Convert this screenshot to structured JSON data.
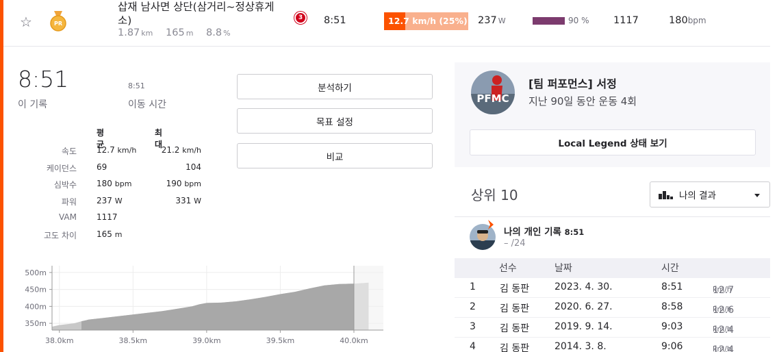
{
  "segment": {
    "name": "삽재 남사면 상단(삼거리~정상휴게소)",
    "distance": "1.87",
    "distance_unit": "km",
    "elev": "165",
    "elev_unit": "m",
    "grade": "8.8",
    "grade_unit": "%",
    "medal_label": "PR",
    "rank_badge": "3",
    "time": "8:51",
    "speed_text": "12.7 km/h (25%)",
    "speed_pct": 0.25,
    "power": "237",
    "power_unit": "W",
    "hr_pct": "90 %",
    "hr_fill": 0.9,
    "vam": "1117",
    "bpm": "180",
    "bpm_unit": "bpm"
  },
  "detail": {
    "elapsed": "8:51",
    "elapsed_label": "이 기록",
    "moving": "8:51",
    "moving_label": "이동 시간",
    "avg_header": "평균",
    "max_header": "최대",
    "rows": [
      {
        "label": "속도",
        "avg": "12.7",
        "avg_unit": "km/h",
        "max": "21.2",
        "max_unit": "km/h"
      },
      {
        "label": "케이던스",
        "avg": "69",
        "avg_unit": "",
        "max": "104",
        "max_unit": ""
      },
      {
        "label": "심박수",
        "avg": "180",
        "avg_unit": "bpm",
        "max": "190",
        "max_unit": "bpm"
      },
      {
        "label": "파워",
        "avg": "237",
        "avg_unit": "W",
        "max": "331",
        "max_unit": "W"
      },
      {
        "label": "VAM",
        "avg": "1117",
        "avg_unit": "",
        "max": "",
        "max_unit": ""
      },
      {
        "label": "고도 차이",
        "avg": "165",
        "avg_unit": "m",
        "max": "",
        "max_unit": ""
      }
    ],
    "buttons": {
      "analyze": "분석하기",
      "goal": "목표 설정",
      "compare": "비교"
    }
  },
  "chart_data": {
    "type": "area",
    "x": [
      37.95,
      38.0,
      38.1,
      38.15,
      38.2,
      38.3,
      38.4,
      38.5,
      38.6,
      38.7,
      38.8,
      38.9,
      38.95,
      39.0,
      39.1,
      39.2,
      39.3,
      39.4,
      39.5,
      39.6,
      39.7,
      39.8,
      39.9,
      40.0,
      40.1
    ],
    "y": [
      340,
      345,
      350,
      356,
      361,
      366,
      371,
      376,
      381,
      386,
      393,
      400,
      406,
      410,
      411,
      415,
      421,
      428,
      436,
      443,
      453,
      462,
      466,
      467,
      470
    ],
    "highlight_range": [
      38.15,
      40.0
    ],
    "x_ticks": [
      "38.0km",
      "38.5km",
      "39.0km",
      "39.5km",
      "40.0km"
    ],
    "x_tick_values": [
      38.0,
      38.5,
      39.0,
      39.5,
      40.0
    ],
    "y_ticks": [
      "350m",
      "400m",
      "450m",
      "500m"
    ],
    "y_tick_values": [
      350,
      400,
      450,
      500
    ],
    "xlim": [
      37.95,
      40.2
    ],
    "ylim": [
      330,
      520
    ],
    "grid": true,
    "colors": {
      "fill": "#c8c8c8",
      "highlight": "#a8a8a8",
      "line": "#bdbdbd"
    }
  },
  "club": {
    "title": "[팀 퍼포먼스] 서정",
    "sub": "지난 90일 동안 운동 4회",
    "logo_text": "PFMC",
    "legend_button": "Local Legend 상태 보기"
  },
  "leaderboard": {
    "title": "상위 10",
    "filter": "나의 결과",
    "pr_title": "나의 개인 기록",
    "pr_time": "8:51",
    "pr_rank": "– /24",
    "headers": {
      "athlete": "선수",
      "date": "날짜",
      "time": "시간"
    },
    "rows": [
      {
        "rank": "1",
        "name": "김 동판",
        "date": "2023. 4. 30.",
        "time": "8:51",
        "speed": "12.7",
        "unit": "km/h"
      },
      {
        "rank": "2",
        "name": "김 동판",
        "date": "2020. 6. 27.",
        "time": "8:58",
        "speed": "12.6",
        "unit": "km/h"
      },
      {
        "rank": "3",
        "name": "김 동판",
        "date": "2019. 9. 14.",
        "time": "9:03",
        "speed": "12.4",
        "unit": "km/h"
      },
      {
        "rank": "4",
        "name": "김 동판",
        "date": "2014. 3. 8.",
        "time": "9:06",
        "speed": "12.4",
        "unit": "km/h"
      }
    ]
  }
}
